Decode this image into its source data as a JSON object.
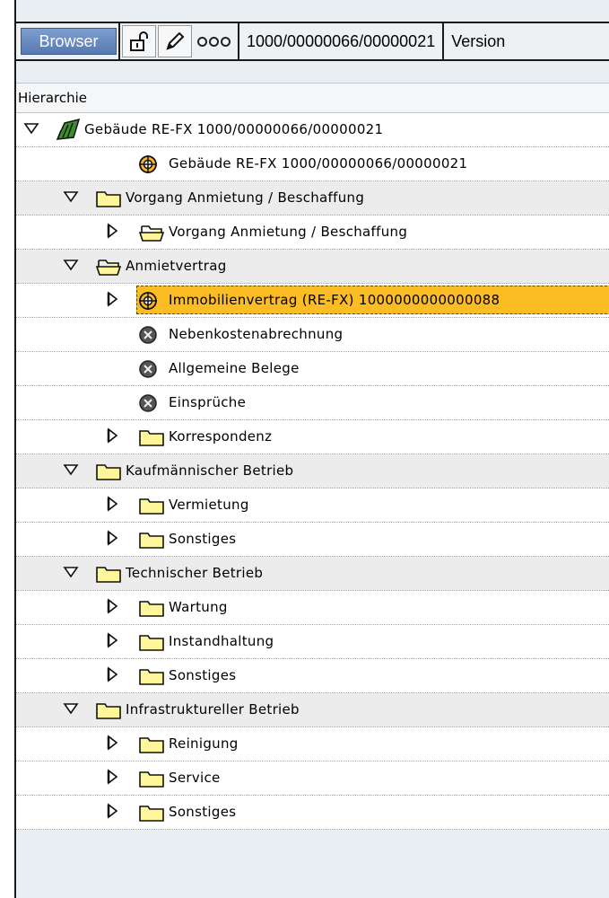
{
  "toolbar": {
    "browser_label": "Browser",
    "lock_icon": "unlock-icon",
    "edit_icon": "pencil-icon",
    "status_icon": "traffic-light-icon",
    "object_id": "1000/00000066/00000021",
    "version_label": "Version"
  },
  "tree": {
    "column_header": "Hierarchie",
    "rows": [
      {
        "label": "Gebäude RE-FX 1000/00000066/00000021",
        "toggle": "expanded",
        "icon": "building-icon",
        "level": 0,
        "bg": "white"
      },
      {
        "label": "Gebäude RE-FX 1000/00000066/00000021",
        "toggle": "none",
        "icon": "target-icon",
        "level": 2,
        "bg": "white"
      },
      {
        "label": "Vorgang Anmietung / Beschaffung",
        "toggle": "expanded",
        "icon": "folder-icon",
        "level": 1,
        "bg": "gray"
      },
      {
        "label": "Vorgang Anmietung / Beschaffung",
        "toggle": "collapsed",
        "icon": "open-folder-icon",
        "level": 2,
        "bg": "white"
      },
      {
        "label": "Anmietvertrag",
        "toggle": "expanded",
        "icon": "open-folder-icon",
        "level": 1,
        "bg": "gray"
      },
      {
        "label": "Immobilienvertrag (RE-FX) 1000000000000088",
        "toggle": "collapsed",
        "icon": "target-icon",
        "level": 2,
        "bg": "white",
        "selected": true
      },
      {
        "label": "Nebenkostenabrechnung",
        "toggle": "none",
        "icon": "cancel-circle-icon",
        "level": 3,
        "bg": "white"
      },
      {
        "label": "Allgemeine Belege",
        "toggle": "none",
        "icon": "cancel-circle-icon",
        "level": 3,
        "bg": "white"
      },
      {
        "label": "Einsprüche",
        "toggle": "none",
        "icon": "cancel-circle-icon",
        "level": 3,
        "bg": "white"
      },
      {
        "label": "Korrespondenz",
        "toggle": "collapsed",
        "icon": "folder-icon",
        "level": 2,
        "bg": "white"
      },
      {
        "label": "Kaufmännischer Betrieb",
        "toggle": "expanded",
        "icon": "folder-icon",
        "level": 1,
        "bg": "gray"
      },
      {
        "label": "Vermietung",
        "toggle": "collapsed",
        "icon": "folder-icon",
        "level": 2,
        "bg": "white"
      },
      {
        "label": "Sonstiges",
        "toggle": "collapsed",
        "icon": "folder-icon",
        "level": 2,
        "bg": "white"
      },
      {
        "label": "Technischer Betrieb",
        "toggle": "expanded",
        "icon": "folder-icon",
        "level": 1,
        "bg": "gray"
      },
      {
        "label": "Wartung",
        "toggle": "collapsed",
        "icon": "folder-icon",
        "level": 2,
        "bg": "white"
      },
      {
        "label": "Instandhaltung",
        "toggle": "collapsed",
        "icon": "folder-icon",
        "level": 2,
        "bg": "white"
      },
      {
        "label": "Sonstiges",
        "toggle": "collapsed",
        "icon": "folder-icon",
        "level": 2,
        "bg": "white"
      },
      {
        "label": "Infrastruktureller Betrieb",
        "toggle": "expanded",
        "icon": "folder-icon",
        "level": 1,
        "bg": "gray"
      },
      {
        "label": "Reinigung",
        "toggle": "collapsed",
        "icon": "folder-icon",
        "level": 2,
        "bg": "white"
      },
      {
        "label": "Service",
        "toggle": "collapsed",
        "icon": "folder-icon",
        "level": 2,
        "bg": "white"
      },
      {
        "label": "Sonstiges",
        "toggle": "collapsed",
        "icon": "folder-icon",
        "level": 2,
        "bg": "white"
      }
    ]
  },
  "colors": {
    "selection": "#fbbd23",
    "folder_fill": "#fff59a",
    "button_blue": "#6a8cc2",
    "panel_bg": "#e9eef3"
  }
}
